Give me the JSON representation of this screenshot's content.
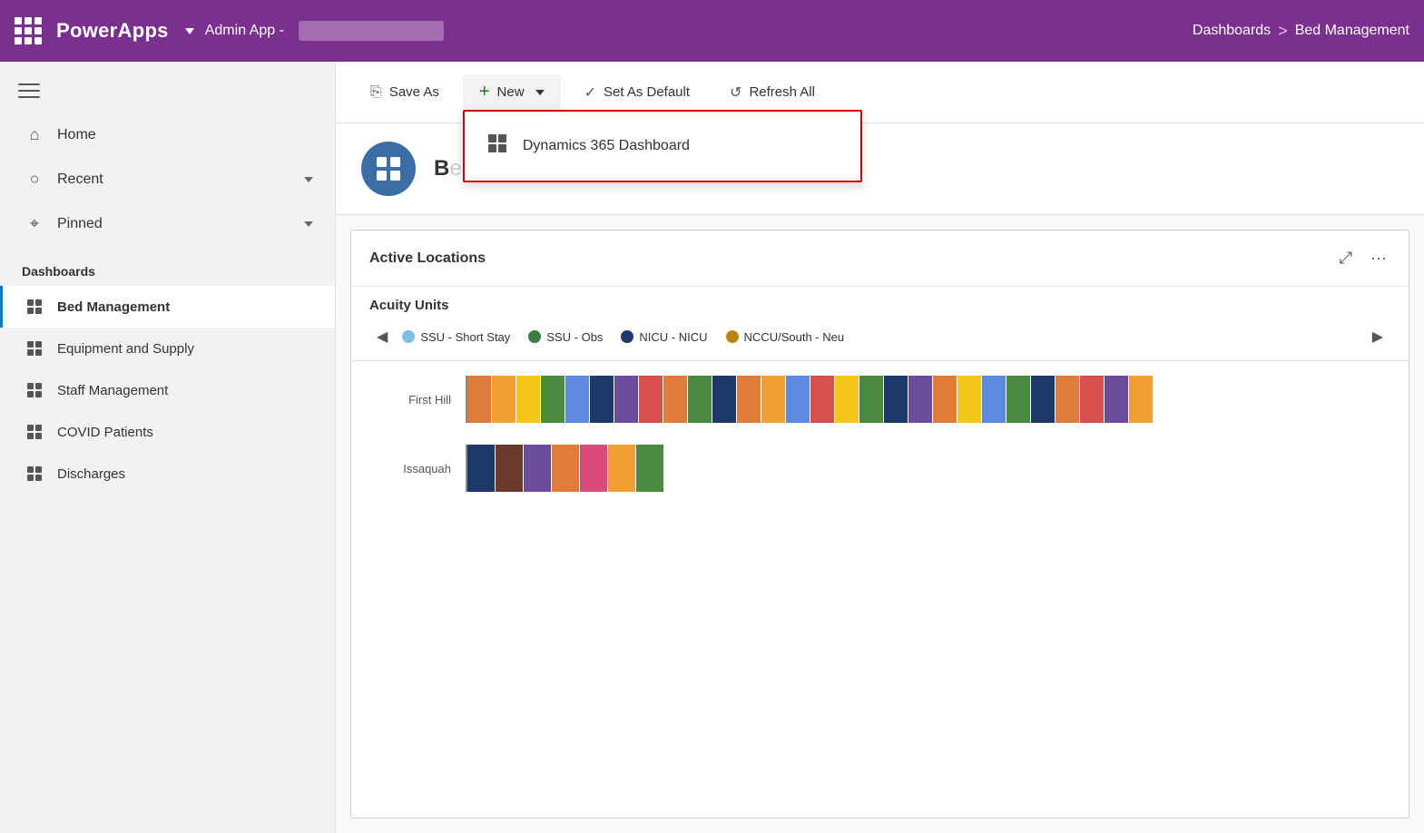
{
  "topbar": {
    "app_name": "PowerApps",
    "admin_app_label": "Admin App -",
    "breadcrumb_section": "Dashboards",
    "breadcrumb_sep": ">",
    "breadcrumb_page": "Bed Management"
  },
  "toolbar": {
    "save_as_label": "Save As",
    "new_label": "New",
    "set_default_label": "Set As Default",
    "refresh_label": "Refresh All"
  },
  "dropdown": {
    "item_label": "Dynamics 365 Dashboard"
  },
  "sidebar": {
    "home_label": "Home",
    "recent_label": "Recent",
    "pinned_label": "Pinned",
    "dashboards_section": "Dashboards",
    "items": [
      {
        "label": "Bed Management",
        "active": true
      },
      {
        "label": "Equipment and Supply",
        "active": false
      },
      {
        "label": "Staff Management",
        "active": false
      },
      {
        "label": "COVID Patients",
        "active": false
      },
      {
        "label": "Discharges",
        "active": false
      }
    ]
  },
  "page": {
    "title_partial": "B"
  },
  "chart": {
    "title": "Active Locations",
    "subtitle": "Acuity Units",
    "legend": [
      {
        "label": "SSU - Short Stay",
        "color": "#7BBFEA"
      },
      {
        "label": "SSU - Obs",
        "color": "#3A7D44"
      },
      {
        "label": "NICU - NICU",
        "color": "#1B3A6B"
      },
      {
        "label": "NCCU/South - Neu",
        "color": "#B8860B"
      }
    ],
    "rows": [
      {
        "label": "First Hill",
        "segments": [
          "#E07B39",
          "#F0A030",
          "#F5C518",
          "#4A8C3F",
          "#5C8AE0",
          "#1B3A6B",
          "#6B4C9A",
          "#D94F4F",
          "#E07B39",
          "#4A8C3F",
          "#1B3A6B",
          "#E07B39",
          "#F0A030",
          "#5C8AE0",
          "#D94F4F",
          "#F5C518",
          "#4A8C3F",
          "#1B3A6B",
          "#6B4C9A",
          "#E07B39",
          "#F5C518",
          "#5C8AE0",
          "#4A8C3F",
          "#1B3A6B",
          "#E07B39",
          "#D94F4F",
          "#6B4C9A",
          "#F0A030"
        ]
      },
      {
        "label": "Issaquah",
        "segments": [
          "#1B3A6B",
          "#6B3A2A",
          "#6B4C9A",
          "#E07B39",
          "#D94C7A",
          "#F0A030",
          "#4A8C3F"
        ]
      }
    ]
  }
}
